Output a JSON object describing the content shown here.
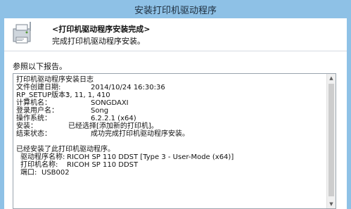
{
  "window": {
    "title": "安装打印机驱动程序"
  },
  "header": {
    "title": "<打印机驱动程序安装完成>",
    "subtitle": "完成打印机驱动程序安装。",
    "icon": "printer-setup-icon"
  },
  "prompt": "参照以下报告。",
  "log": {
    "heading": "打印机驱动程序安装日志",
    "created_label": "文件创建日期:",
    "created_value": "2014/10/24 16:30:36",
    "rp_setup_label": "RP_SETUP版本：",
    "rp_setup_value": "3, 11, 1, 410",
    "computer_label": "计算机名：",
    "computer_value": "SONGDAXI",
    "user_label": "登录用户名：",
    "user_value": "Song",
    "os_label": "操作系统：",
    "os_value": "6.2.2.1 (x64)",
    "install_label": "安装：",
    "install_value": "已经选择[添加新的打印机]。",
    "result_label": "结束状态：",
    "result_value": "成功完成打印机驱动程序安装。",
    "installed_heading": "已经安装了此打印机驱动程序。",
    "driver_name_label": "驱动程序名称:",
    "driver_name_value": "RICOH SP 110 DDST [Type 3 - User-Mode (x64)]",
    "printer_name_label": "打印机名称:",
    "printer_name_value": "RICOH SP 110 DDST",
    "port_label": "端口:",
    "port_value": "USB002"
  },
  "colors": {
    "title_bar": "#8ec1e6",
    "header_bg": "#ffffff"
  }
}
